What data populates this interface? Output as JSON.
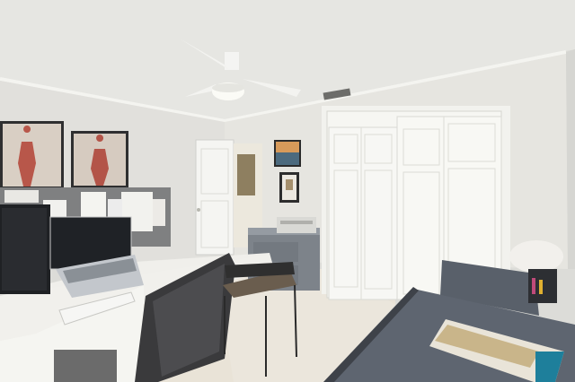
{
  "scene": {
    "description_icons": [
      "ceiling-fan-icon",
      "anatomy-poster-icon",
      "laptop-icon",
      "monitor-icon",
      "office-chair-icon",
      "closet-door-icon",
      "printer-icon",
      "magazine-icon"
    ]
  },
  "colors": {
    "ceiling": "#e6e6e2",
    "wall": "#e4e3de",
    "wall_right": "#dadad5",
    "trim": "#f4f4f0",
    "floor": "#e8e2d6",
    "desk": "#f1f0ec",
    "desk_dark": "#5b626b",
    "chair": "#3a3a3c",
    "poster": "#d9cfc4",
    "muscle": "#b8574a",
    "corkboard": "#8a8a88"
  }
}
